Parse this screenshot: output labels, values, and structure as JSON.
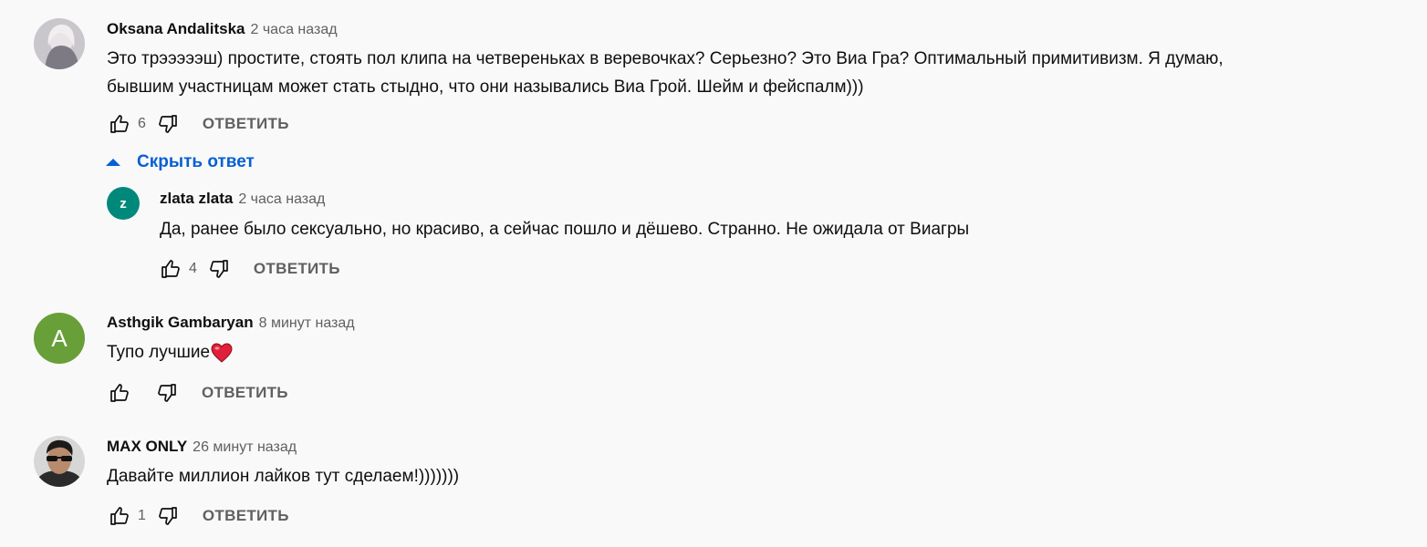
{
  "comments": [
    {
      "author": "Oksana Andalitska",
      "time": "2 часа назад",
      "text_line1": "Это трэээээш) простите, стоять пол клипа на четвереньках в веревочках? Серьезно? Это Виа Гра? Оптимальный примитивизм. Я думаю,",
      "text_line2": "бывшим участницам может стать стыдно, что они назывались Виа Грой. Шейм и фейспалм)))",
      "likes": "6",
      "reply_label": "ОТВЕТИТЬ",
      "avatar": "photo-avatar-woman"
    },
    {
      "author": "Asthgik Gambaryan",
      "time": "8 минут назад",
      "text": "Тупо лучшие",
      "emoji": "heart-emoji",
      "likes": "",
      "reply_label": "ОТВЕТИТЬ",
      "avatar_letter": "A",
      "avatar_color": "#689f38"
    },
    {
      "author": "MAX ONLY",
      "time": "26 минут назад",
      "text": "Давайте миллион лайков тут сделаем!)))))))",
      "likes": "1",
      "reply_label": "ОТВЕТИТЬ",
      "avatar": "photo-avatar-man-sunglasses"
    }
  ],
  "replies_toggle": {
    "label": "Скрыть ответ",
    "color": "#065fd4"
  },
  "reply": {
    "author": "zlata zlata",
    "time": "2 часа назад",
    "text": "Да, ранее было сексуально, но красиво, а сейчас пошло и дёшево. Странно. Не ожидала от Виагры",
    "likes": "4",
    "reply_label": "ОТВЕТИТЬ",
    "avatar_letter": "z",
    "avatar_color": "#00897b"
  }
}
